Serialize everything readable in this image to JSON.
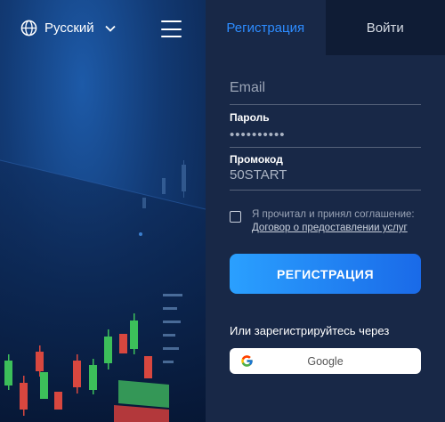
{
  "header": {
    "language": "Русский"
  },
  "tabs": [
    {
      "label": "Регистрация",
      "active": true
    },
    {
      "label": "Войти",
      "active": false
    }
  ],
  "form": {
    "email": {
      "placeholder": "Email"
    },
    "password": {
      "label": "Пароль",
      "value": "••••••••••"
    },
    "promo": {
      "label": "Промокод",
      "value": "50START"
    },
    "agreement": {
      "text": "Я прочитал и принял соглашение:",
      "link": "Договор о предоставлении услуг"
    },
    "submit_label": "РЕГИСТРАЦИЯ",
    "or_text": "Или зарегистрируйтесь через",
    "google_label": "Google"
  },
  "colors": {
    "accent": "#2d8cff",
    "panel": "#182847",
    "background": "#0c1e3d"
  }
}
